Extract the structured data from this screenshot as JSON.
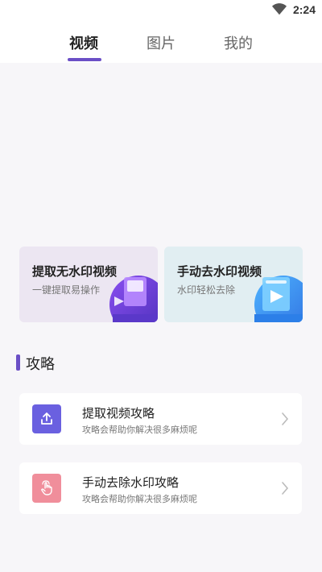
{
  "status_bar": {
    "time": "2:24",
    "wifi_icon": "wifi-icon"
  },
  "tabs": [
    {
      "label": "视频",
      "active": true
    },
    {
      "label": "图片",
      "active": false
    },
    {
      "label": "我的",
      "active": false
    }
  ],
  "features": [
    {
      "title": "提取无水印视频",
      "subtitle": "一键提取易操作",
      "icon": "purple-video-illustration"
    },
    {
      "title": "手动去水印视频",
      "subtitle": "水印轻松去除",
      "icon": "blue-video-illustration"
    }
  ],
  "section": {
    "title": "攻略"
  },
  "guides": [
    {
      "title": "提取视频攻略",
      "subtitle": "攻略会帮助你解决很多麻烦呢",
      "icon": "upload-icon"
    },
    {
      "title": "手动去除水印攻略",
      "subtitle": "攻略会帮助你解决很多麻烦呢",
      "icon": "hand-tap-icon"
    }
  ],
  "colors": {
    "accent": "#6b4fc6",
    "upload": "#6a60e0",
    "hand": "#f08e9b"
  }
}
